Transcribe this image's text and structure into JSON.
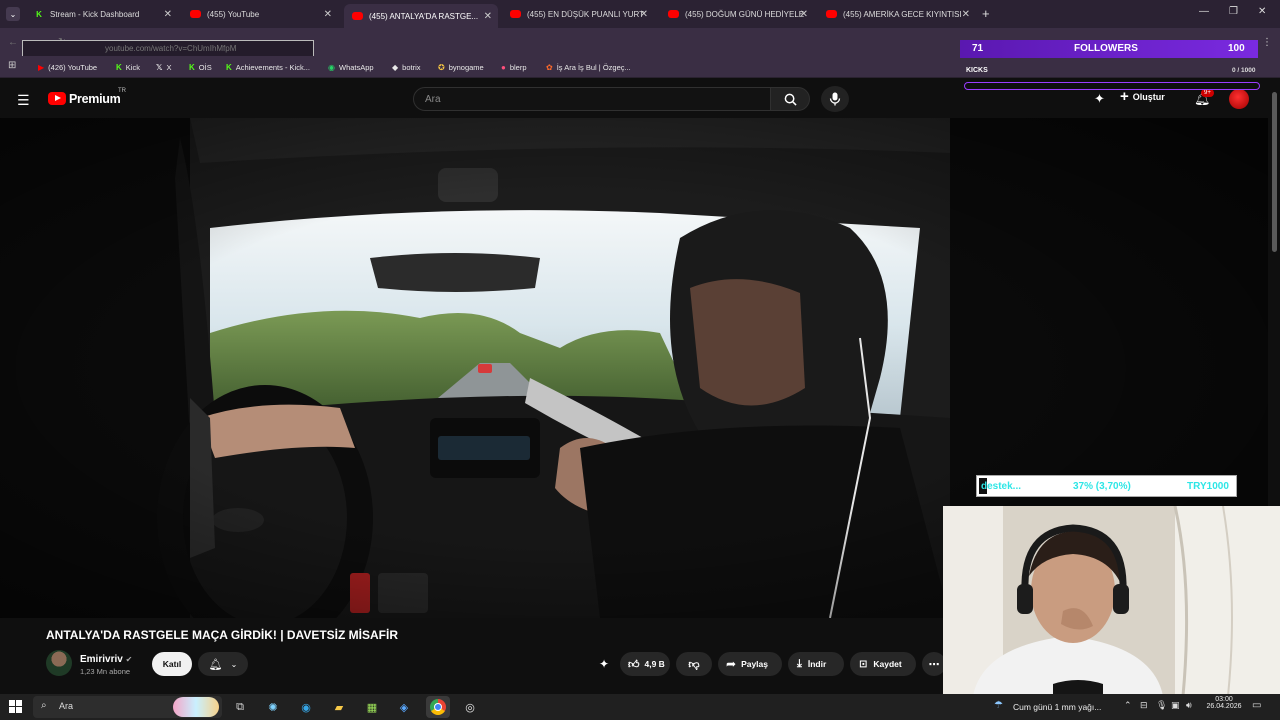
{
  "browser": {
    "tabs": [
      {
        "label": "Stream - Kick Dashboard",
        "icon": "kick-icon"
      },
      {
        "label": "(455) YouTube",
        "icon": "youtube-icon"
      },
      {
        "label": "(455) ANTALYA'DA RASTGE...",
        "icon": "youtube-icon",
        "active": true
      },
      {
        "label": "(455) EN DÜŞÜK PUANLI YURT",
        "icon": "youtube-icon"
      },
      {
        "label": "(455) DOĞUM GÜNÜ HEDİYELE",
        "icon": "youtube-icon"
      },
      {
        "label": "(455) AMERİKA GECE KIYINTISI",
        "icon": "youtube-icon"
      }
    ],
    "url": "youtube.com/watch?v=ChUmIhMfpM",
    "bookmarks": [
      "(426) YouTube",
      "Kick",
      "X",
      "OİS",
      "Achievements - Kick...",
      "WhatsApp",
      "botrix",
      "bynogame",
      "blerp",
      "İş Ara İş Bul | Özgeç..."
    ]
  },
  "youtube": {
    "logo_text": "Premium",
    "logo_badge": "TR",
    "search_placeholder": "Ara",
    "create_label": "Oluştur",
    "notif_count": "9+"
  },
  "video": {
    "title": "ANTALYA'DA RASTGELE MAÇA GİRDİK! | DAVETSİZ MİSAFİR",
    "channel": "Emirivriv",
    "subscribers": "1,23 Mn abone",
    "join_label": "Katıl",
    "likes": "4,9 B",
    "share_label": "Paylaş",
    "download_label": "İndir",
    "save_label": "Kaydet"
  },
  "overlay": {
    "followers_count": "71",
    "followers_label": "FOLLOWERS",
    "followers_goal": "100",
    "kicks_label": "KICKS",
    "kicks_progress": "0 / 1000",
    "kicks_fraction": 0,
    "donate_label": "destek...",
    "donate_percent": "37% (3,70%)",
    "donate_goal": "TRY1000"
  },
  "taskbar": {
    "search_label": "Ara",
    "weather": "Cum günü 1 mm yağı...",
    "time": "03:00",
    "date": "26.04.2026"
  },
  "colors": {
    "accent": "#ff0000",
    "kick": "#53fc18",
    "overlay_purple": "#7a2ae0",
    "donate_cyan": "#2ee6e6"
  }
}
